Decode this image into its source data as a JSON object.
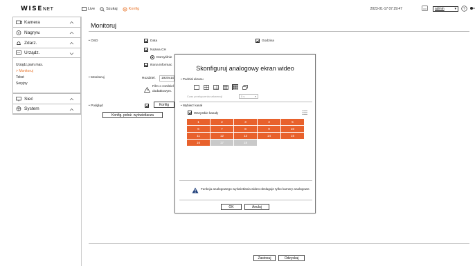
{
  "header": {
    "logo_main": "WISE",
    "logo_suffix": "NET",
    "nav": [
      {
        "label": "Live",
        "icon": "monitor-icon"
      },
      {
        "label": "Szukaj",
        "icon": "search-icon"
      },
      {
        "label": "Konfig",
        "icon": "gear-icon"
      }
    ],
    "datetime": "2023-01-17 07:29:47",
    "user": "admin"
  },
  "sidebar": {
    "items": [
      {
        "label": "Kamera",
        "icon": "camera-icon"
      },
      {
        "label": "Nagryw.",
        "icon": "record-icon"
      },
      {
        "label": "Zdarz.",
        "icon": "bell-icon"
      },
      {
        "label": "Urządz.",
        "icon": "device-icon",
        "subitems": [
          "Urządz.pam.mas.",
          "Monitoruj",
          "Tekst",
          "Seryjny"
        ]
      },
      {
        "label": "Sieć",
        "icon": "network-icon"
      },
      {
        "label": "System",
        "icon": "system-icon"
      }
    ]
  },
  "main": {
    "title": "Monitoruj",
    "osd_label": "OSD",
    "osd": {
      "data": "Data",
      "godzina": "Godzina",
      "nazwa_ch": "Nazwa CH",
      "domyslnie": "Domyślnie",
      "ikona": "Ikona informac"
    },
    "monitoruj_label": "Monitoruj",
    "rozdziel_label": "Rozdziel.",
    "rozdziel_value": "1920x10",
    "film_note_1": "Film o rozdziel",
    "film_note_2": "dodatkowym.",
    "podglad_label": "Podgląd",
    "konfig_button": "Konfig",
    "konfig_polozenie_button": "Konfig. położ. wyświetlacza",
    "apply_button": "Zastosuj",
    "cancel_button": "Odzyskaj"
  },
  "modal": {
    "title": "Skonfiguruj analogowy ekran wideo",
    "split_label": "Podział ekranu",
    "seq_label": "Czas przełączenia sekwencji",
    "seq_value": "5 s",
    "channel_label": "Wybierz kanał",
    "all_channels": "Wszystkie kanały",
    "channels": [
      {
        "n": "1",
        "on": true
      },
      {
        "n": "2",
        "on": true
      },
      {
        "n": "3",
        "on": true
      },
      {
        "n": "4",
        "on": true
      },
      {
        "n": "5",
        "on": true
      },
      {
        "n": "6",
        "on": true
      },
      {
        "n": "7",
        "on": true
      },
      {
        "n": "8",
        "on": true
      },
      {
        "n": "9",
        "on": true
      },
      {
        "n": "10",
        "on": true
      },
      {
        "n": "11",
        "on": true
      },
      {
        "n": "12",
        "on": true
      },
      {
        "n": "13",
        "on": true
      },
      {
        "n": "14",
        "on": true
      },
      {
        "n": "15",
        "on": true
      },
      {
        "n": "16",
        "on": true
      },
      {
        "n": "17",
        "on": false
      },
      {
        "n": "18",
        "on": false
      }
    ],
    "warning": "Funkcja analogowego wyświetlania wideo obsługuje tylko kamery analogowe.",
    "ok": "OK",
    "cancel": "Anuluj"
  },
  "colors": {
    "accent": "#e8742a",
    "channel_on": "#e8612c",
    "channel_off": "#c9c9c9"
  }
}
